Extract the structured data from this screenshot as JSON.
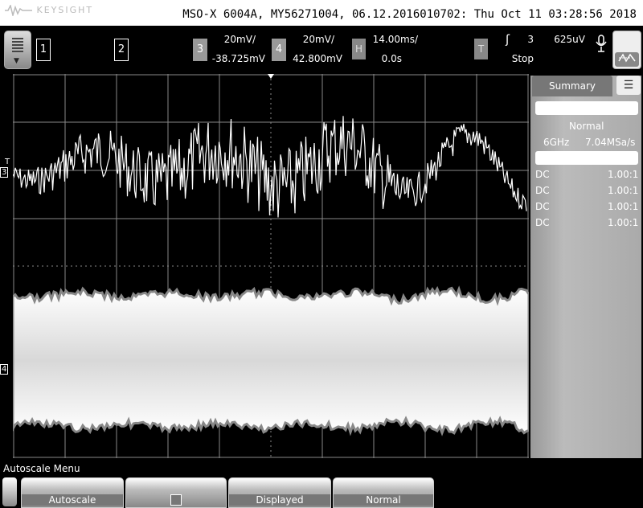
{
  "header": {
    "brand": "KEYSIGHT",
    "instrument_info": "MSO-X 6004A, MY56271004, 06.12.2016010702: Thu Oct 11 03:28:56 2018"
  },
  "channels": {
    "ch1_label": "1",
    "ch2_label": "2",
    "ch3_label": "3",
    "ch3_scale": "20mV/",
    "ch3_offset": "-38.725mV",
    "ch4_label": "4",
    "ch4_scale": "20mV/",
    "ch4_offset": "42.800mV"
  },
  "horizontal": {
    "label": "H",
    "timebase": "14.00ms/",
    "delay": "0.0s"
  },
  "trigger": {
    "label": "T",
    "edge_symbol": "ʃ",
    "source": "3",
    "level": "625uV",
    "status": "Stop"
  },
  "markers": {
    "trigger_marker": "T",
    "ch3_marker": "3",
    "ch4_marker": "4"
  },
  "summary": {
    "tab_label": "Summary",
    "acq_mode": "Normal",
    "bandwidth": "6GHz",
    "sample_rate": "7.04MSa/s",
    "coupling_rows": [
      {
        "coupling": "DC",
        "probe": "1.00:1"
      },
      {
        "coupling": "DC",
        "probe": "1.00:1"
      },
      {
        "coupling": "DC",
        "probe": "1.00:1"
      },
      {
        "coupling": "DC",
        "probe": "1.00:1"
      }
    ]
  },
  "bottom": {
    "menu_title": "Autoscale Menu",
    "softkeys": [
      "Autoscale",
      "",
      "Displayed",
      "Normal"
    ]
  },
  "icons": {
    "menu": "menu-icon",
    "mic": "microphone-icon",
    "run": "run-stop-icon"
  }
}
